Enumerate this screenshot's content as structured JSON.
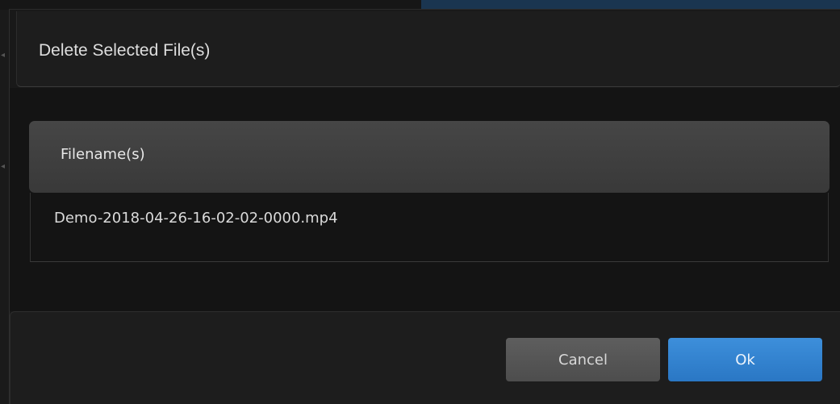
{
  "dialog": {
    "title": "Delete Selected File(s)"
  },
  "file_table": {
    "column_header": "Filename(s)",
    "rows": [
      {
        "filename": "Demo-2018-04-26-16-02-02-0000.mp4"
      }
    ]
  },
  "footer": {
    "cancel_label": "Cancel",
    "ok_label": "Ok"
  },
  "colors": {
    "ok_accent": "#2f80d0",
    "cancel_gray": "#555555",
    "background_dark": "#1b1b1b"
  }
}
